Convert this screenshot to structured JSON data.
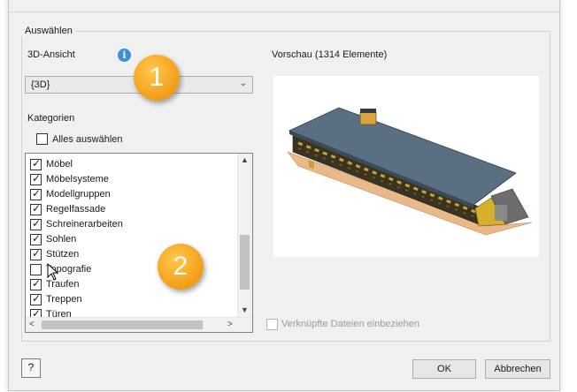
{
  "group": {
    "title": "Auswählen"
  },
  "view": {
    "label": "3D-Ansicht",
    "selected": "{3D}",
    "info_icon": "info-icon"
  },
  "preview": {
    "label": "Vorschau (1314 Elemente)"
  },
  "categories": {
    "label": "Kategorien",
    "select_all": {
      "label": "Alles auswählen",
      "checked": false
    },
    "items": [
      {
        "label": "Möbel",
        "checked": true
      },
      {
        "label": "Möbelsysteme",
        "checked": true
      },
      {
        "label": "Modellgruppen",
        "checked": true
      },
      {
        "label": "Regelfassade",
        "checked": true
      },
      {
        "label": "Schreinerarbeiten",
        "checked": true
      },
      {
        "label": "Sohlen",
        "checked": true
      },
      {
        "label": "Stützen",
        "checked": true
      },
      {
        "label": "Topografie",
        "checked": false
      },
      {
        "label": "Traufen",
        "checked": true
      },
      {
        "label": "Treppen",
        "checked": true
      },
      {
        "label": "Türen",
        "checked": true
      }
    ]
  },
  "linked_files": {
    "label": "Verknüpfte Dateien einbeziehen",
    "checked": false,
    "enabled": false
  },
  "callouts": {
    "one": "1",
    "two": "2"
  },
  "buttons": {
    "ok": "OK",
    "cancel": "Abbrechen",
    "help": "?"
  },
  "colors": {
    "accent_badge": "#f5a623",
    "info_blue": "#3f8fd8",
    "dialog_bg": "#f0f0f0"
  }
}
